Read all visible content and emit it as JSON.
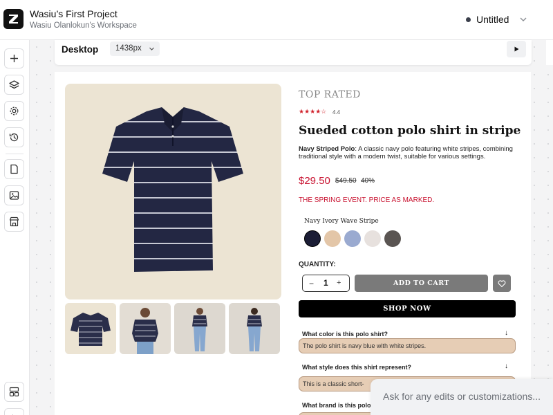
{
  "header": {
    "project_title": "Wasiu’s First Project",
    "workspace": "Wasiu Olanlokun's Workspace",
    "document_name": "Untitled"
  },
  "sidebar": {
    "icons": [
      "plus-icon",
      "layers-icon",
      "gear-icon",
      "history-icon",
      "page-icon",
      "image-icon",
      "store-icon",
      "layout-icon"
    ]
  },
  "toolbar": {
    "device_label": "Desktop",
    "width_value": "1438px"
  },
  "product": {
    "eyebrow": "TOP RATED",
    "stars": "★★★★☆",
    "rating": "4.4",
    "title": "Sueded cotton polo shirt in stripe",
    "desc_bold": "Navy Striped Polo",
    "desc_rest": ": A classic navy polo featuring white stripes, combining traditional style with a modern twist, suitable for various settings.",
    "price": "$29.50",
    "old_price": "$49.50",
    "discount": "40%",
    "promo": "THE SPRING EVENT. PRICE AS MARKED.",
    "color_name": "Navy Ivory Wave Stripe",
    "swatches": [
      "#1b1d35",
      "#e3c6a8",
      "#9aaad0",
      "#e7e1de",
      "#5a5552"
    ],
    "quantity_label": "QUANTITY:",
    "quantity": "1",
    "add_to_cart": "ADD TO CART",
    "shop_now": "SHOP NOW"
  },
  "faq": [
    {
      "q": "What color is this polo shirt?",
      "a": "The polo shirt is navy blue with white stripes."
    },
    {
      "q": "What style does this shirt represent?",
      "a": "This is a classic short-"
    },
    {
      "q": "What brand is this polo",
      "a": ""
    }
  ],
  "prompt": {
    "placeholder": "Ask for any edits or customizations..."
  }
}
